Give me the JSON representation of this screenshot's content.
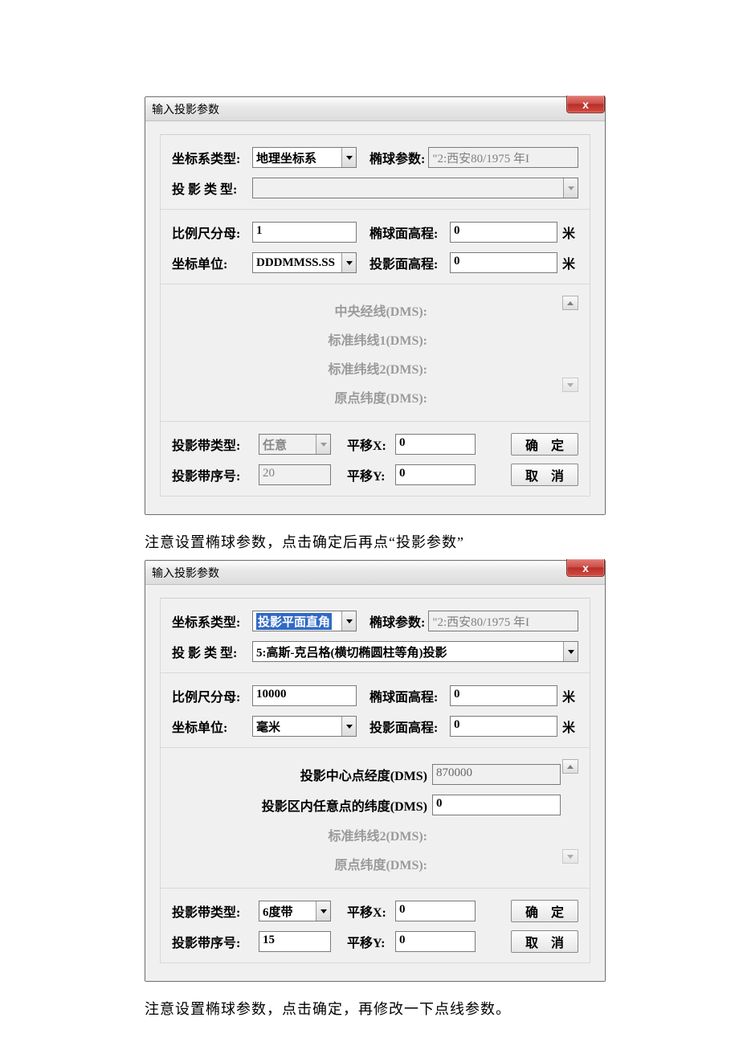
{
  "dialog1": {
    "title": "输入投影参数",
    "close": "x",
    "coord_sys_label": "坐标系类型:",
    "coord_sys_value": "地理坐标系",
    "ellipsoid_label": "椭球参数:",
    "ellipsoid_value": "\"2:西安80/1975 年I",
    "proj_type_label": "投 影 类 型:",
    "proj_type_value": "",
    "scale_label": "比例尺分母:",
    "scale_value": "1",
    "ellip_h_label": "椭球面高程:",
    "ellip_h_value": "0",
    "ellip_h_unit": "米",
    "coord_unit_label": "坐标单位:",
    "coord_unit_value": "DDDMMSS.SS",
    "proj_h_label": "投影面高程:",
    "proj_h_value": "0",
    "proj_h_unit": "米",
    "mid1": "中央经线(DMS):",
    "mid2": "标准纬线1(DMS):",
    "mid3": "标准纬线2(DMS):",
    "mid4": "原点纬度(DMS):",
    "zone_type_label": "投影带类型:",
    "zone_type_value": "任意",
    "offset_x_label": "平移X:",
    "offset_x_value": "0",
    "zone_no_label": "投影带序号:",
    "zone_no_value": "20",
    "offset_y_label": "平移Y:",
    "offset_y_value": "0",
    "ok": "确 定",
    "cancel": "取 消"
  },
  "paragraph1": "注意设置椭球参数，点击确定后再点“投影参数”",
  "dialog2": {
    "title": "输入投影参数",
    "close": "x",
    "coord_sys_label": "坐标系类型:",
    "coord_sys_value": "投影平面直角",
    "ellipsoid_label": "椭球参数:",
    "ellipsoid_value": "\"2:西安80/1975 年I",
    "proj_type_label": "投 影 类 型:",
    "proj_type_value": "5:高斯-克吕格(横切椭圆柱等角)投影",
    "scale_label": "比例尺分母:",
    "scale_value": "10000",
    "ellip_h_label": "椭球面高程:",
    "ellip_h_value": "0",
    "ellip_h_unit": "米",
    "coord_unit_label": "坐标单位:",
    "coord_unit_value": "毫米",
    "proj_h_label": "投影面高程:",
    "proj_h_value": "0",
    "proj_h_unit": "米",
    "mid1_label": "投影中心点经度(DMS)",
    "mid1_value": "870000",
    "mid2_label": "投影区内任意点的纬度(DMS)",
    "mid2_value": "0",
    "mid3": "标准纬线2(DMS):",
    "mid4": "原点纬度(DMS):",
    "zone_type_label": "投影带类型:",
    "zone_type_value": "6度带",
    "offset_x_label": "平移X:",
    "offset_x_value": "0",
    "zone_no_label": "投影带序号:",
    "zone_no_value": "15",
    "offset_y_label": "平移Y:",
    "offset_y_value": "0",
    "ok": "确 定",
    "cancel": "取 消"
  },
  "paragraph2": "注意设置椭球参数，点击确定，再修改一下点线参数。"
}
